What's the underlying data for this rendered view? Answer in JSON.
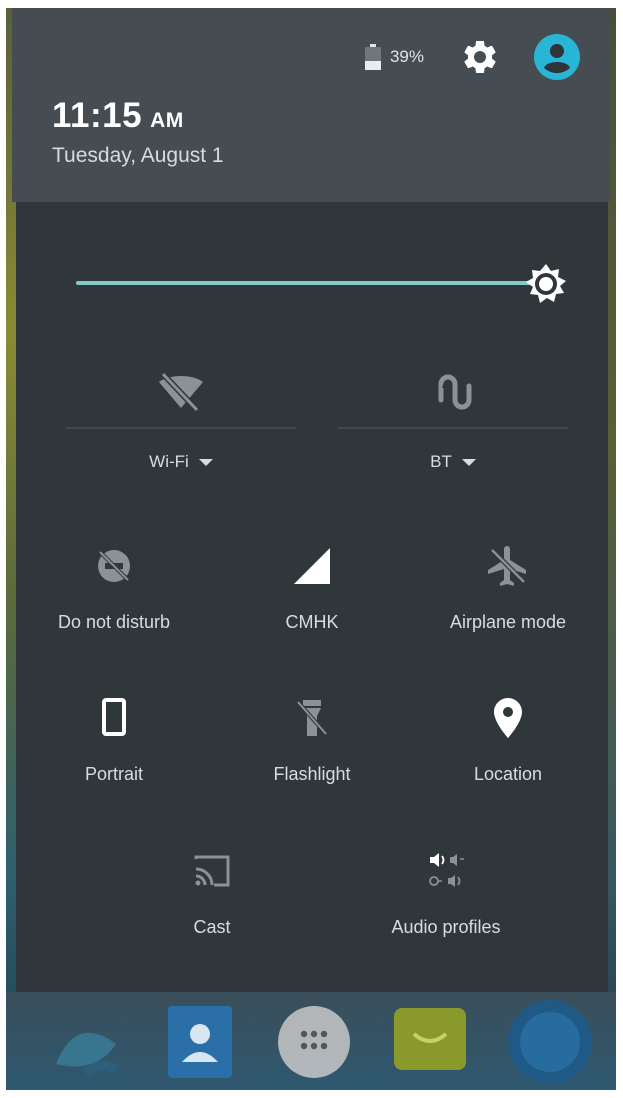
{
  "status": {
    "battery_percent": "39%",
    "battery_level": 0.39
  },
  "header": {
    "time": "11:15",
    "ampm": "AM",
    "date": "Tuesday, August 1"
  },
  "brightness": {
    "level": 1.0
  },
  "dual_tiles": [
    {
      "label": "Wi-Fi",
      "icon": "wifi-off-icon"
    },
    {
      "label": "BT",
      "icon": "bluetooth-off-icon"
    }
  ],
  "tiles": [
    {
      "label": "Do not disturb",
      "icon": "do-not-disturb-icon"
    },
    {
      "label": "CMHK",
      "icon": "cellular-signal-icon"
    },
    {
      "label": "Airplane mode",
      "icon": "airplane-icon"
    },
    {
      "label": "Portrait",
      "icon": "portrait-rotation-icon"
    },
    {
      "label": "Flashlight",
      "icon": "flashlight-off-icon"
    },
    {
      "label": "Location",
      "icon": "location-pin-icon"
    },
    {
      "label": "Cast",
      "icon": "cast-icon"
    },
    {
      "label": "Audio profiles",
      "icon": "audio-profiles-icon"
    }
  ],
  "dock": [
    "phone-icon",
    "contacts-icon",
    "apps-launcher-icon",
    "messaging-icon",
    "browser-icon"
  ],
  "colors": {
    "accent": "#80cbc4",
    "avatar": "#29b6d6",
    "panel": "#2f373b",
    "header": "#454d52"
  }
}
